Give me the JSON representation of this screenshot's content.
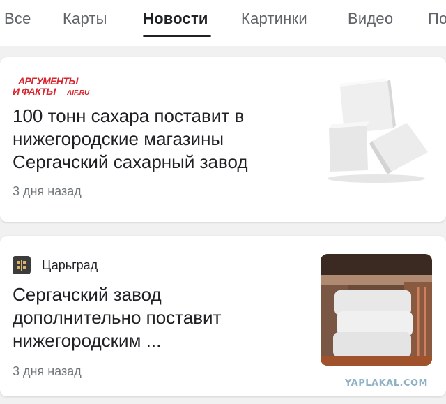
{
  "tabs": [
    {
      "label": "Все"
    },
    {
      "label": "Карты"
    },
    {
      "label": "Новости"
    },
    {
      "label": "Картинки"
    },
    {
      "label": "Видео"
    },
    {
      "label": "По"
    }
  ],
  "active_tab": "Новости",
  "articles": [
    {
      "source": "Аргументы и факты",
      "source_logo_text": [
        "АРГУМЕНТЫ",
        "И ФАКТЫ",
        "AIF.RU"
      ],
      "headline": "100 тонн сахара поставит в нижегородские магазины Сергачский сахарный завод",
      "time": "3 дня назад",
      "thumbnail": "sugar-cubes"
    },
    {
      "source": "Царьград",
      "headline": "Сергачский завод дополнительно поставит нижегородским ...",
      "time": "3 дня назад",
      "thumbnail": "sugar-sacks-warehouse"
    }
  ],
  "watermark": "YAPLAKAL.COM",
  "colors": {
    "aif_red": "#d7262d",
    "text_primary": "#202124",
    "text_secondary": "#70757a",
    "tab_inactive": "#5f6368",
    "background": "#f1f1f1"
  }
}
